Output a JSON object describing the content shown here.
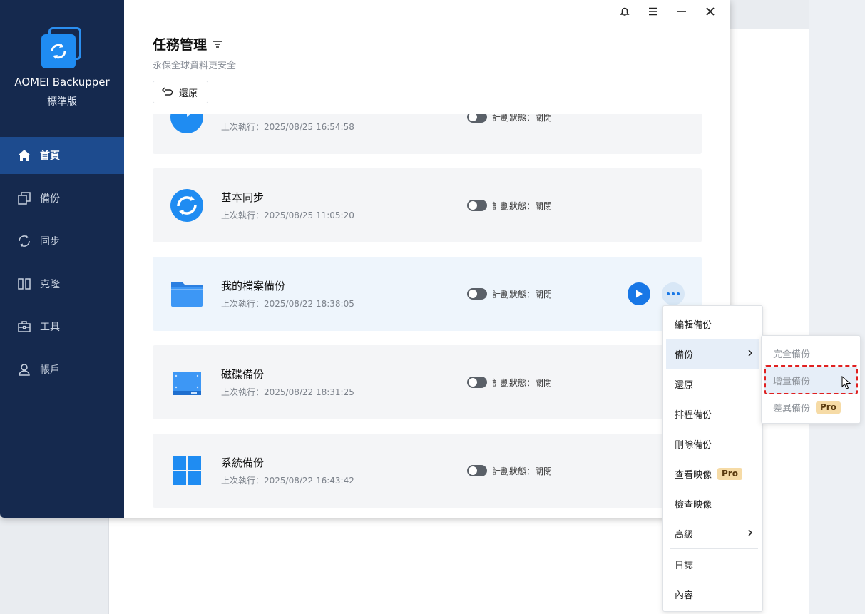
{
  "app": {
    "brand": "AOMEI Backupper",
    "edition": "標準版"
  },
  "nav": [
    {
      "label": "首頁",
      "icon": "home-icon",
      "active": true
    },
    {
      "label": "備份",
      "icon": "backup-icon",
      "active": false
    },
    {
      "label": "同步",
      "icon": "sync-icon",
      "active": false
    },
    {
      "label": "克隆",
      "icon": "clone-icon",
      "active": false
    },
    {
      "label": "工具",
      "icon": "toolbox-icon",
      "active": false
    },
    {
      "label": "帳戶",
      "icon": "user-icon",
      "active": false
    }
  ],
  "header": {
    "title": "任務管理",
    "subtitle": "永保全球資料更安全",
    "restore_label": "還原"
  },
  "tasks": [
    {
      "name": "",
      "last_run": "上次執行：2025/08/25 16:54:58",
      "status": "計劃狀態：關閉",
      "icon": "partial-backup-icon"
    },
    {
      "name": "基本同步",
      "last_run": "上次執行：2025/08/25 11:05:20",
      "status": "計劃狀態：關閉",
      "icon": "sync-circle-icon"
    },
    {
      "name": "我的檔案備份",
      "last_run": "上次執行：2025/08/22 18:38:05",
      "status": "計劃狀態：關閉",
      "icon": "folder-icon"
    },
    {
      "name": "磁碟備份",
      "last_run": "上次執行：2025/08/22 18:31:25",
      "status": "計劃狀態：關閉",
      "icon": "disk-icon"
    },
    {
      "name": "系統備份",
      "last_run": "上次執行：2025/08/22 16:43:42",
      "status": "計劃狀態：關閉",
      "icon": "windows-icon"
    }
  ],
  "menu": {
    "items": [
      "編輯備份",
      "備份",
      "還原",
      "排程備份",
      "刪除備份",
      "查看映像",
      "檢查映像",
      "高級",
      "日誌",
      "內容"
    ],
    "pro_label": "Pro"
  },
  "submenu": {
    "items": [
      "完全備份",
      "增量備份",
      "差異備份"
    ],
    "pro_label": "Pro"
  },
  "colors": {
    "sidebar": "#15294e",
    "sidebar_active": "#1d4b8e",
    "accent": "#1877e6",
    "highlight": "#e02020"
  }
}
